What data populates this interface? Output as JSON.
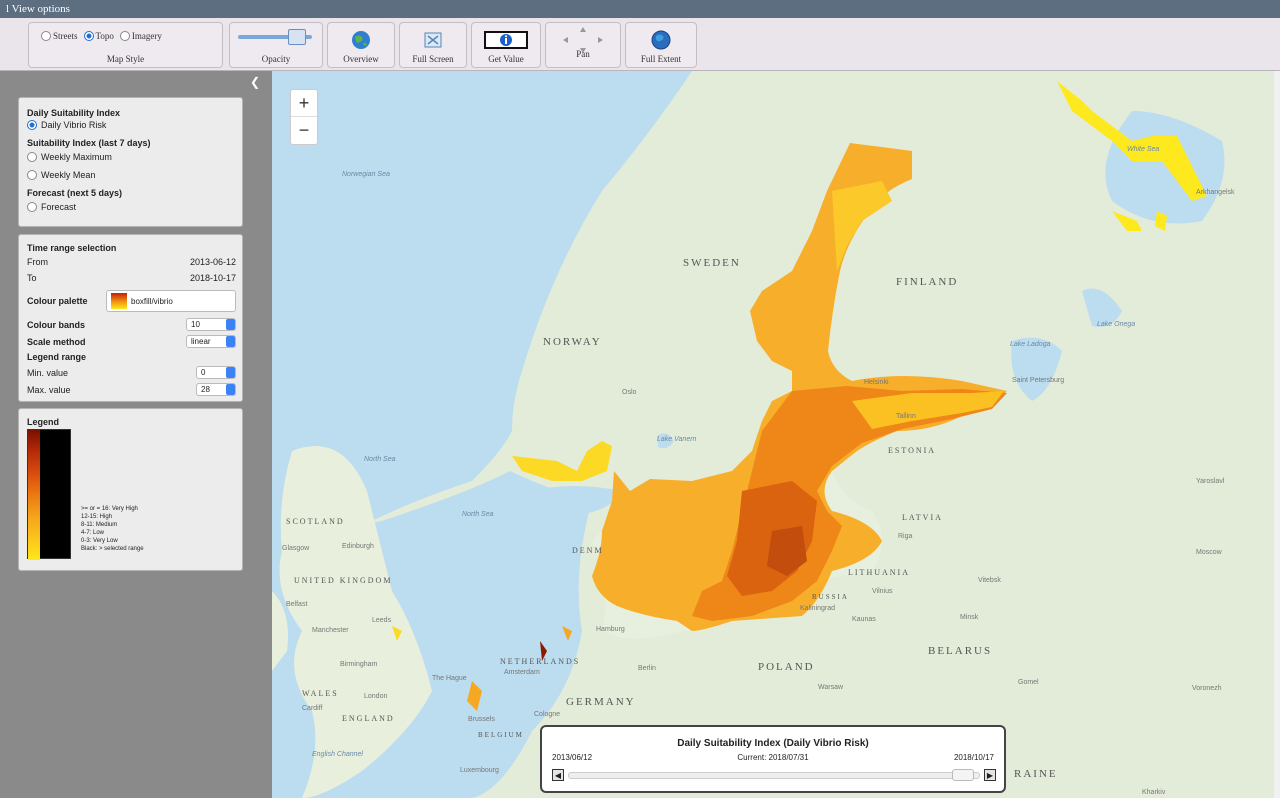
{
  "window": {
    "title": "l View options"
  },
  "toolbar": {
    "map_style": {
      "label": "Map Style",
      "options": [
        "Streets",
        "Topo",
        "Imagery"
      ],
      "selected": "Topo"
    },
    "opacity": {
      "label": "Opacity",
      "value": 0.8
    },
    "overview": {
      "label": "Overview"
    },
    "full_screen": {
      "label": "Full Screen"
    },
    "get_value": {
      "label": "Get Value"
    },
    "pan": {
      "label": "Pan"
    },
    "full_extent": {
      "label": "Full Extent"
    }
  },
  "layer_panel": {
    "heading1": "Daily Suitability Index",
    "opt_daily": "Daily Vibrio Risk",
    "heading2": "Suitability Index (last 7 days)",
    "opt_weekly_max": "Weekly Maximum",
    "opt_weekly_mean": "Weekly Mean",
    "heading3": "Forecast (next 5 days)",
    "opt_forecast": "Forecast"
  },
  "settings_panel": {
    "title": "Time range selection",
    "from_label": "From",
    "from_value": "2013-06-12",
    "to_label": "To",
    "to_value": "2018-10-17",
    "palette_label": "Colour palette",
    "palette_value": "boxfill/vibrio",
    "bands_label": "Colour bands",
    "bands_value": "10",
    "scale_label": "Scale method",
    "scale_value": "linear",
    "legend_range_label": "Legend range",
    "min_label": "Min. value",
    "min_value": "0",
    "max_label": "Max. value",
    "max_value": "28"
  },
  "legend": {
    "title": "Legend",
    "entries": [
      ">= or = 16: Very High",
      "12-15: High",
      "8-11: Medium",
      "4-7: Low",
      "0-3: Very Low",
      "Black: > selected range"
    ]
  },
  "map": {
    "countries": [
      "SWEDEN",
      "FINLAND",
      "NORWAY",
      "ESTONIA",
      "LATVIA",
      "LITHUANIA",
      "RUSSIA",
      "POLAND",
      "BELARUS",
      "GERMANY",
      "NETHERLANDS",
      "UNITED KINGDOM",
      "SCOTLAND",
      "ENGLAND",
      "WALES",
      "DENM",
      "BELGIUM",
      "RAINE"
    ],
    "seas": [
      "Norwegian Sea",
      "North Sea",
      "North Sea",
      "White Sea",
      "English Channel",
      "Lake Vanern",
      "Lake Ladoga",
      "Lake Onega"
    ],
    "cities": [
      "Oslo",
      "Helsinki",
      "Tallinn",
      "Saint Petersburg",
      "Arkhangelsk",
      "Riga",
      "Vilnius",
      "Minsk",
      "Moscow",
      "Hamburg",
      "Berlin",
      "Amsterdam",
      "The Hague",
      "Brussels",
      "London",
      "Cardiff",
      "Birmingham",
      "Manchester",
      "Leeds",
      "Edinburgh",
      "Glasgow",
      "Belfast",
      "Warsaw",
      "Cologne",
      "Luxembourg",
      "Yaroslavl",
      "Vitebsk",
      "Gomel",
      "Kharkiv",
      "Voronezh",
      "Kaunas",
      "Kaliningrad"
    ]
  },
  "timeslider": {
    "title": "Daily Suitability Index (Daily Vibrio Risk)",
    "start": "2013/06/12",
    "current": "Current:  2018/07/31",
    "end": "2018/10/17"
  },
  "colors": {
    "very_high": "#8b1a00",
    "high": "#d2470b",
    "medium": "#ec7a12",
    "low": "#f6a41c",
    "very_low": "#fde81a",
    "sea": "#b8dbee",
    "land": "#e3ecd9"
  }
}
